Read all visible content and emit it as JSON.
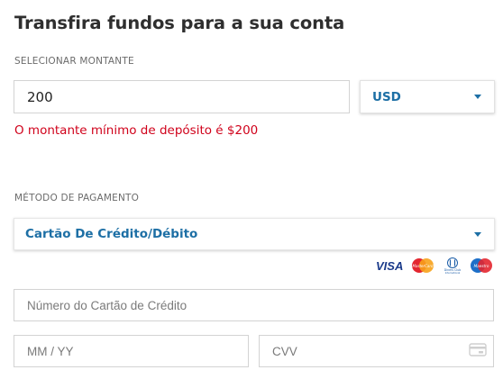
{
  "title": "Transfira fundos para a sua conta",
  "amount": {
    "label": "SELECIONAR MONTANTE",
    "value": "200",
    "currency": "USD",
    "error": "O montante mínimo de depósito é $200"
  },
  "payment": {
    "label": "MÉTODO DE PAGAMENTO",
    "selected": "Cartão De Crédito/Débito",
    "card_logos": [
      "visa-logo",
      "mastercard-logo",
      "diners-club-logo",
      "maestro-logo"
    ],
    "logo_text": {
      "visa": "VISA",
      "mastercard": "MasterCard",
      "diners": "Diners Club International",
      "maestro": "Maestro"
    },
    "card_number_placeholder": "Número do Cartão de Crédito",
    "expiry_placeholder": "MM / YY",
    "cvv_placeholder": "CVV"
  },
  "colors": {
    "accent": "#1d6fa5",
    "error": "#d0021b",
    "border": "#d3d3d3"
  }
}
